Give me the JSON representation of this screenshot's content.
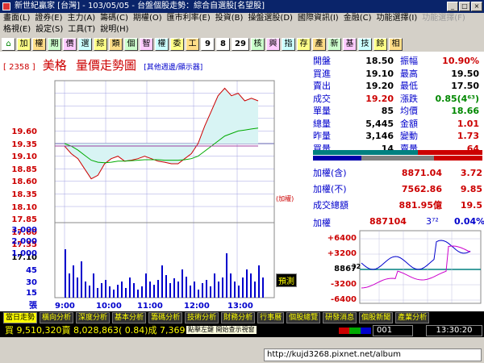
{
  "window": {
    "title": "新世紀贏家 [台灣] - 103/05/05 - 台盤個股走勢：綜合自選股[名望股]",
    "btn_min": "_",
    "btn_max": "□",
    "btn_close": "×"
  },
  "menu": {
    "row1": [
      {
        "label": "畫面(L)"
      },
      {
        "label": "證券(E)"
      },
      {
        "label": "主力(A)"
      },
      {
        "label": "籌碼(C)"
      },
      {
        "label": "期權(O)"
      },
      {
        "label": "匯市利率(E)"
      },
      {
        "label": "投資(B)"
      },
      {
        "label": "操盤選股(D)"
      },
      {
        "label": "國際資訊(I)"
      },
      {
        "label": "金融(C)"
      },
      {
        "label": "功能選擇(I)"
      },
      {
        "label": "功能選擇(F)",
        "disabled": true
      }
    ],
    "row2": [
      {
        "label": "格視(E)"
      },
      {
        "label": "設定(S)"
      },
      {
        "label": "工具(T)"
      },
      {
        "label": "說明(H)"
      }
    ]
  },
  "toolbar": {
    "home": "⌂",
    "buttons": [
      "加",
      "權",
      "期",
      "價",
      "選",
      "綜",
      "類",
      "個",
      "智",
      "權",
      "委",
      "工",
      "9",
      "8",
      "29",
      "核",
      "興",
      "指",
      "存",
      "產",
      "新",
      "基",
      "技",
      "餘",
      "相"
    ]
  },
  "chart": {
    "code": "[ 2358 ]",
    "name": "美格",
    "title": "量價走勢圖",
    "link": "[其他週邊/顯示器]",
    "y_labels": [
      "19.60",
      "19.35",
      "19.10",
      "18.85",
      "18.60",
      "18.35",
      "18.10",
      "17.85",
      "17.60",
      "17.35",
      "17.10"
    ],
    "vol_labels": [
      "3,000",
      "2,000",
      "1,000",
      "45",
      "30",
      "15",
      "張"
    ],
    "x_labels": [
      "9:00",
      "10:00",
      "11:00",
      "12:00",
      "13:00"
    ],
    "avg_tag": "(加權)",
    "forecast": "預測",
    "colors": {
      "price": "#cc0000",
      "avg": "#00aa00",
      "volume": "#0000cc",
      "fill": "#d8f4f4",
      "ref": "#8080c0"
    }
  },
  "quote": {
    "rows": [
      {
        "k1": "開盤",
        "v1": "18.50",
        "k2": "振幅",
        "v2": "10.90%",
        "c1": "blk",
        "c2": "red"
      },
      {
        "k1": "買進",
        "v1": "19.10",
        "k2": "最高",
        "v2": "19.50",
        "c1": "blk",
        "c2": "blk"
      },
      {
        "k1": "賣出",
        "v1": "19.20",
        "k2": "最低",
        "v2": "17.50",
        "c1": "blk",
        "c2": "blk"
      },
      {
        "k1": "成交",
        "v1": "19.20",
        "k2": "漲跌",
        "v2": "0.85(4⁶³)",
        "c1": "red",
        "c2": "grn"
      },
      {
        "k1": "單量",
        "v1": "85",
        "k2": "均價",
        "v2": "18.66",
        "c1": "blk",
        "c2": "grn"
      },
      {
        "k1": "總量",
        "v1": "5,445",
        "k2": "金額",
        "v2": "1.01",
        "c1": "blk",
        "c2": "red"
      },
      {
        "k1": "昨量",
        "v1": "3,146",
        "k2": "變動",
        "v2": "1.73",
        "c1": "blk",
        "c2": "red"
      },
      {
        "k1": "買量",
        "v1": "14",
        "k2": "賣量",
        "v2": "64",
        "c1": "blk",
        "c2": "red"
      }
    ]
  },
  "index": {
    "rows": [
      {
        "k": "加權(含)",
        "v": "8871.04",
        "v2": "3.72"
      },
      {
        "k": "加權(不)",
        "v": "7562.86",
        "v2": "9.85"
      },
      {
        "k": "成交總額",
        "v": "881.95億",
        "v2": "19.5"
      }
    ]
  },
  "mini": {
    "label": "加權",
    "value": "887104",
    "change": "3⁷²",
    "pct": "0.04%",
    "y_labels": [
      "+6400",
      "+3200",
      "8867",
      "-3200",
      "-6400"
    ],
    "marker": "32"
  },
  "tabs": [
    "當日走勢",
    "橫向分析",
    "深度分析",
    "基本分析",
    "籌碼分析",
    "技術分析",
    "財務分析",
    "行事曆",
    "個股總覽",
    "研發消息",
    "個股新聞",
    "產業分析"
  ],
  "status": {
    "ticker": "買 9,510,320賣 8,028,863( 0.84)成 7,369,547,張  均張 6.2",
    "hint": "點擊左鍵 開始查示視窗",
    "code": "001",
    "clock": "13:30:20"
  },
  "address": {
    "url": "http://kujd3268.pixnet.net/album"
  }
}
